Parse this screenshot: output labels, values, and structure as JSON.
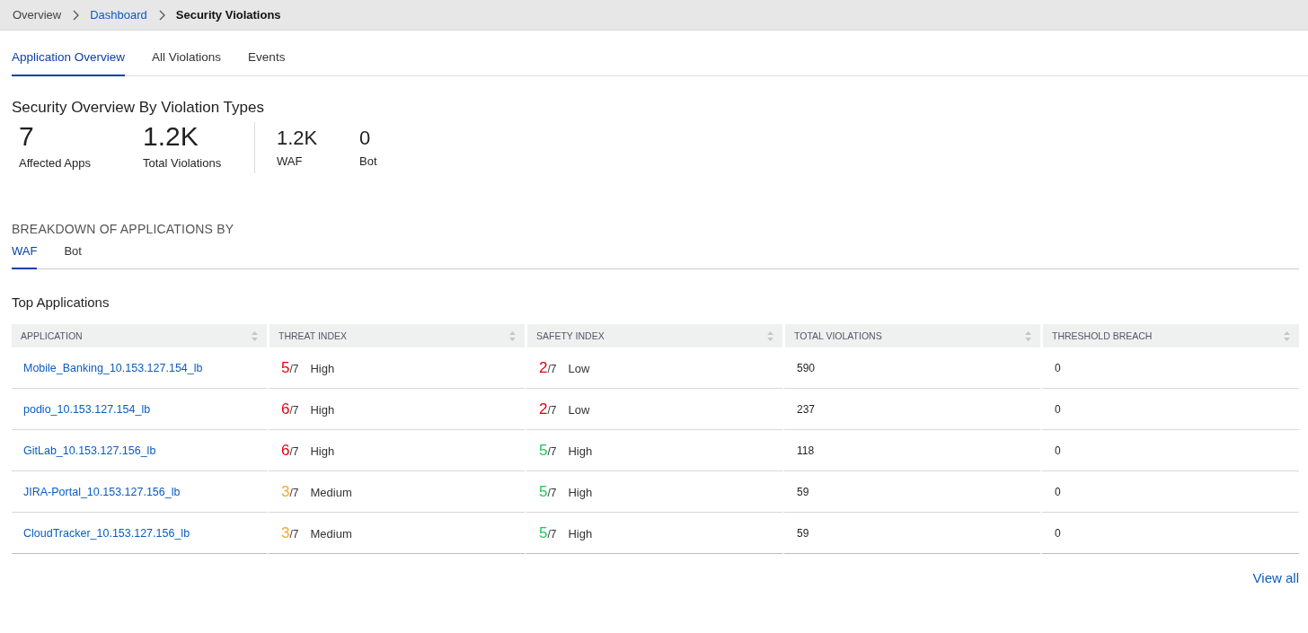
{
  "breadcrumb": [
    {
      "label": "Overview",
      "kind": "plain"
    },
    {
      "label": "Dashboard",
      "kind": "link"
    },
    {
      "label": "Security Violations",
      "kind": "current"
    }
  ],
  "tabs": [
    {
      "label": "Application Overview",
      "selected": true
    },
    {
      "label": "All Violations",
      "selected": false
    },
    {
      "label": "Events",
      "selected": false
    }
  ],
  "overview": {
    "title": "Security Overview By Violation Types",
    "summary": [
      {
        "value": "7",
        "label": "Affected Apps"
      },
      {
        "value": "1.2K",
        "label": "Total Violations"
      }
    ],
    "by_type": [
      {
        "value": "1.2K",
        "label": "WAF"
      },
      {
        "value": "0",
        "label": "Bot"
      }
    ]
  },
  "breakdown": {
    "title": "BREAKDOWN OF APPLICATIONS BY",
    "tabs": [
      {
        "label": "WAF",
        "selected": true
      },
      {
        "label": "Bot",
        "selected": false
      }
    ]
  },
  "table": {
    "title": "Top Applications",
    "columns": [
      "APPLICATION",
      "THREAT INDEX",
      "SAFETY INDEX",
      "TOTAL VIOLATIONS",
      "THRESHOLD BREACH"
    ],
    "rows": [
      {
        "application": "Mobile_Banking_10.153.127.154_lb",
        "threat": {
          "score": "5",
          "scale": "/7",
          "label": "High",
          "color": "#e5000f"
        },
        "safety": {
          "score": "2",
          "scale": "/7",
          "label": "Low",
          "color": "#e5000f"
        },
        "total": "590",
        "breach": "0"
      },
      {
        "application": "podio_10.153.127.154_lb",
        "threat": {
          "score": "6",
          "scale": "/7",
          "label": "High",
          "color": "#e5000f"
        },
        "safety": {
          "score": "2",
          "scale": "/7",
          "label": "Low",
          "color": "#e5000f"
        },
        "total": "237",
        "breach": "0"
      },
      {
        "application": "GitLab_10.153.127.156_lb",
        "threat": {
          "score": "6",
          "scale": "/7",
          "label": "High",
          "color": "#e5000f"
        },
        "safety": {
          "score": "5",
          "scale": "/7",
          "label": "High",
          "color": "#1ec95a"
        },
        "total": "118",
        "breach": "0"
      },
      {
        "application": "JIRA-Portal_10.153.127.156_lb",
        "threat": {
          "score": "3",
          "scale": "/7",
          "label": "Medium",
          "color": "#f7a733"
        },
        "safety": {
          "score": "5",
          "scale": "/7",
          "label": "High",
          "color": "#1ec95a"
        },
        "total": "59",
        "breach": "0"
      },
      {
        "application": "CloudTracker_10.153.127.156_lb",
        "threat": {
          "score": "3",
          "scale": "/7",
          "label": "Medium",
          "color": "#f7a733"
        },
        "safety": {
          "score": "5",
          "scale": "/7",
          "label": "High",
          "color": "#1ec95a"
        },
        "total": "59",
        "breach": "0"
      }
    ]
  },
  "view_all": "View all"
}
